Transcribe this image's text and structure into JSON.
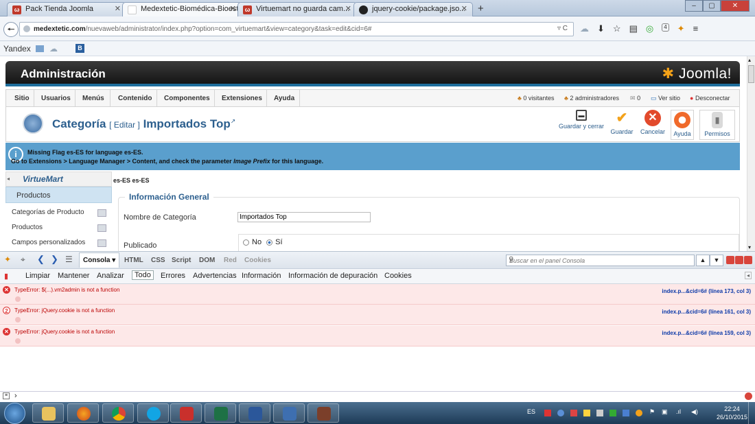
{
  "browser": {
    "tabs": [
      {
        "label": "Pack Tienda Joomla",
        "icon": "joomla-icon",
        "active": false
      },
      {
        "label": "Medextetic-Biomédica-Bioesté...",
        "icon": "page-icon",
        "active": true
      },
      {
        "label": "Virtuemart no guarda cam...",
        "icon": "joomla-icon",
        "active": false
      },
      {
        "label": "jquery-cookie/package.jso...",
        "icon": "github-icon",
        "active": false
      }
    ],
    "new_tab": "+",
    "url_host": "medextetic.com",
    "url_path": "/nuevaweb/administrator/index.php?option=com_virtuemart&view=category&task=edit&cid=6#",
    "notif_count": "4"
  },
  "yandex": {
    "label": "Yandex"
  },
  "admin": {
    "title": "Administración",
    "logo": "Joomla!",
    "menu": [
      "Sitio",
      "Usuarios",
      "Menús",
      "Contenido",
      "Componentes",
      "Extensiones",
      "Ayuda"
    ],
    "status": {
      "visitors": "0 visitantes",
      "admins": "2 administradores",
      "messages": "0",
      "view_site": "Ver sitio",
      "logout": "Desconectar"
    }
  },
  "toolbar": {
    "title_main": "Categoría",
    "title_action": "[ Editar ]",
    "title_item": "Importados Top",
    "buttons": [
      {
        "label": "Guardar y cerrar",
        "icon": "save-icon"
      },
      {
        "label": "Guardar",
        "icon": "checkmark-icon"
      },
      {
        "label": "Cancelar",
        "icon": "cancel-icon"
      },
      {
        "label": "Ayuda",
        "icon": "help-icon"
      },
      {
        "label": "Permisos",
        "icon": "lock-icon"
      }
    ]
  },
  "message": {
    "line1": "Missing Flag es-ES for language es-ES.",
    "line2_prefix": "Go to Extensions > Language Manager > Content, and check the parameter",
    "line2_em": "Image Prefix",
    "line2_suffix": "for this language."
  },
  "sidebar": {
    "logo": "VirtueMart",
    "section": "Productos",
    "items": [
      "Categorías de Producto",
      "Productos",
      "Campos personalizados"
    ]
  },
  "form": {
    "lang_line": "es-ES es-ES",
    "legend": "Información General",
    "name_label": "Nombre de Categoría",
    "name_value": "Importados Top",
    "published_label": "Publicado",
    "published_no": "No",
    "published_yes": "Sí",
    "published_selected": "Sí"
  },
  "firebug": {
    "panels": [
      "Consola",
      "HTML",
      "CSS",
      "Script",
      "DOM",
      "Red",
      "Cookies"
    ],
    "active_panel": "Consola",
    "search_placeholder": "Buscar en el panel Consola",
    "filters": [
      "Limpiar",
      "Mantener",
      "Analizar",
      "Todo",
      "Errores",
      "Advertencias",
      "Información",
      "Información de depuración",
      "Cookies"
    ],
    "active_filter": "Todo",
    "errors": [
      {
        "count": "",
        "message": "TypeError: $(...).vm2admin is not a function",
        "source": "index.p...&cid=6# (línea 173, col 3)"
      },
      {
        "count": "2",
        "message": "TypeError: jQuery.cookie is not a function",
        "source": "index.p...&cid=6# (línea 161, col 3)"
      },
      {
        "count": "",
        "message": "TypeError: jQuery.cookie is not a function",
        "source": "index.p...&cid=6# (línea 159, col 3)"
      }
    ],
    "prompt": "›"
  },
  "taskbar": {
    "apps": [
      "explorer-icon",
      "firefox-icon",
      "chrome-icon",
      "skype-icon",
      "pdf-icon",
      "excel-icon",
      "word-icon",
      "save-icon",
      "app-icon"
    ],
    "lang": "ES",
    "time": "22:24",
    "date": "26/10/2015"
  }
}
